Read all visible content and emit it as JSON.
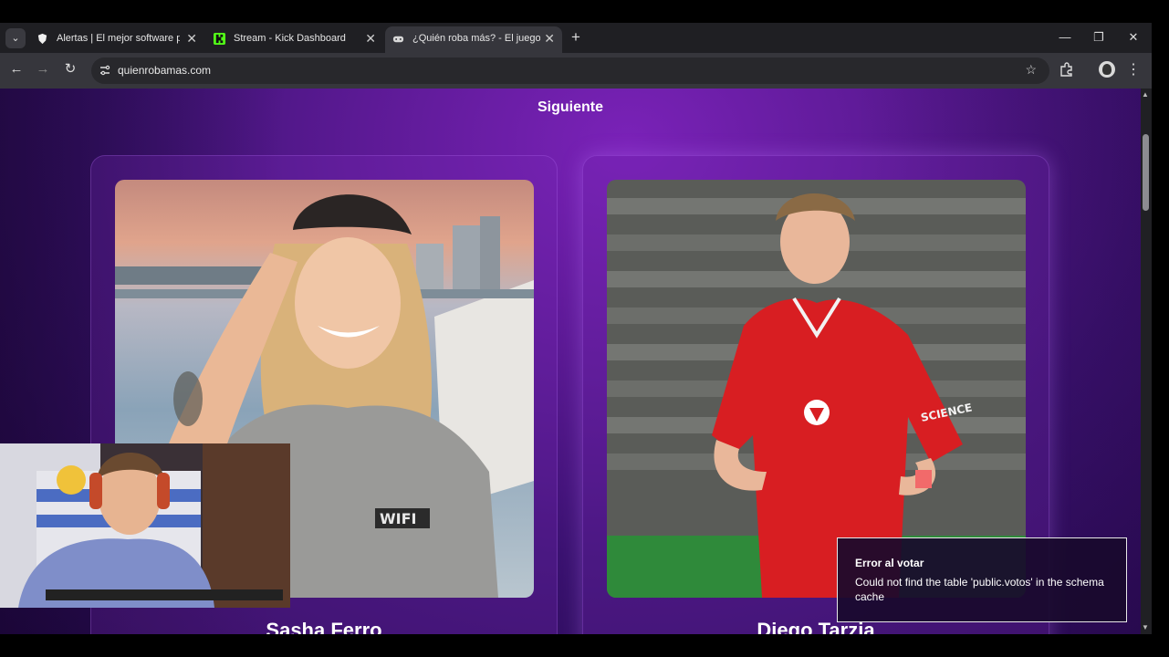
{
  "browser": {
    "tabs": [
      {
        "label": "Alertas | El mejor software para",
        "active": false
      },
      {
        "label": "Stream - Kick Dashboard",
        "active": false
      },
      {
        "label": "¿Quién roba más? - El juego qu",
        "active": true
      }
    ],
    "url": "quienrobamas.com"
  },
  "page": {
    "next_label": "Siguiente",
    "cards": [
      {
        "name": "Sasha Ferro",
        "shirt_text": "WIFI"
      },
      {
        "name": "Diego Tarzia",
        "sponsor_text": "SCIENCE"
      }
    ]
  },
  "toast": {
    "title": "Error al votar",
    "message": "Could not find the table 'public.votos' in the schema cache"
  },
  "colors": {
    "page_purple": "#5c1a95",
    "accent_purple": "#7a22b8",
    "kick_green": "#53fc18"
  }
}
